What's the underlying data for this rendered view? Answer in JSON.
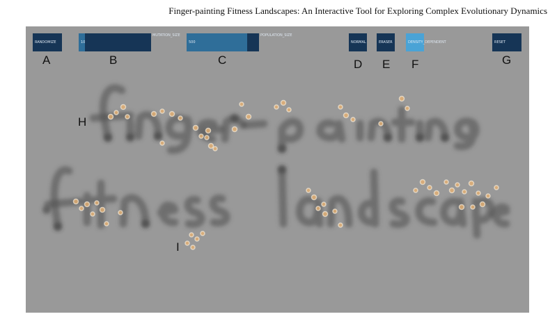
{
  "title": "Finger-painting Fitness Landscapes: An Interactive Tool for Exploring Complex Evolutionary Dynamics",
  "controls": {
    "randomize": {
      "label": "RANDOMIZE"
    },
    "mutation_rate": {
      "value_text": "10",
      "name": "MUTATION_SIZE",
      "fill": 0.09
    },
    "population_size": {
      "value_text": "500",
      "name": "POPULATION_SIZE",
      "fill": 0.84
    },
    "normal": {
      "label": "NORMAL"
    },
    "erase": {
      "label": "ERASER"
    },
    "density": {
      "label": "DENSITY_DEPENDENT"
    },
    "reset": {
      "label": "RESET"
    }
  },
  "figure_labels": [
    "A",
    "B",
    "C",
    "D",
    "E",
    "F",
    "G",
    "H",
    "I"
  ],
  "colors": {
    "canvas": "#999999",
    "button": "#163556",
    "slider_fill": "#2f6e99",
    "active_button": "#4aa3d6",
    "paint_stroke": "#4d4d4d",
    "organism": "#e6b072"
  }
}
